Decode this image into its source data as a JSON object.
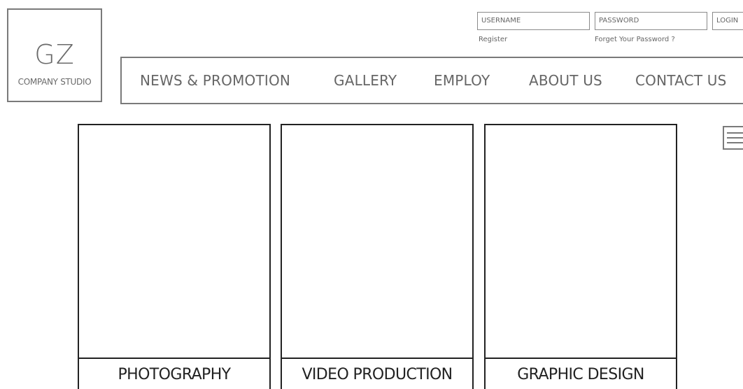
{
  "logo": {
    "mark": "GZ",
    "subtitle": "COMPANY STUDIO"
  },
  "login": {
    "username_placeholder": "USERNAME",
    "password_placeholder": "PASSWORD",
    "login_label": "LOGIN",
    "register_link": "Register",
    "forgot_link": "Forget Your Password ?"
  },
  "nav": {
    "items": [
      {
        "label": "NEWS & PROMOTION"
      },
      {
        "label": "GALLERY"
      },
      {
        "label": "EMPLOY"
      },
      {
        "label": "ABOUT US"
      },
      {
        "label": "CONTACT US"
      }
    ]
  },
  "menu_icon": "hamburger-menu-icon",
  "cards": [
    {
      "label": "PHOTOGRAPHY"
    },
    {
      "label": "VIDEO PRODUCTION"
    },
    {
      "label": "GRAPHIC DESIGN"
    }
  ]
}
